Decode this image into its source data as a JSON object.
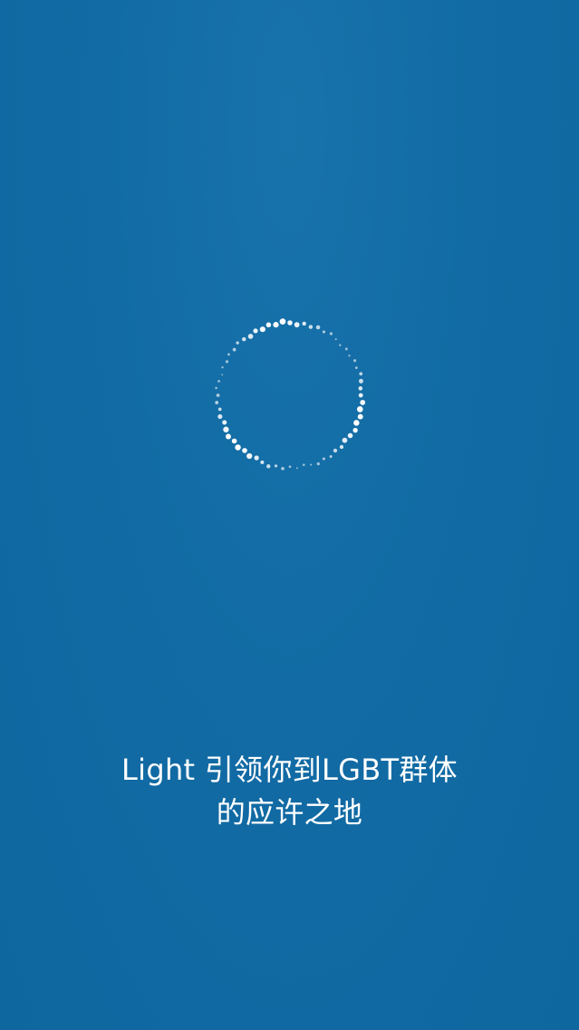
{
  "splash": {
    "tagline_line1": "Light 引领你到LGBT群体",
    "tagline_line2": "的应许之地"
  },
  "loader": {
    "icon": "dotted-ring-icon",
    "color": "#ffffff"
  },
  "colors": {
    "background": "#116aa3"
  }
}
